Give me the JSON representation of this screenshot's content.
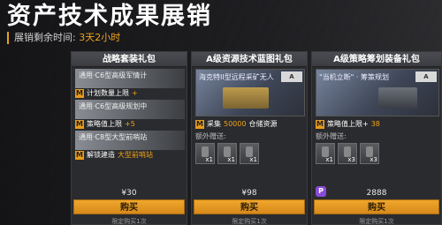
{
  "header": {
    "title": "资产技术成果展销",
    "remaining_label": "展销剩余时间:",
    "remaining_value": "3天2小时"
  },
  "cards": [
    {
      "title": "战略套装礼包",
      "items": [
        {
          "text": "通用·C6型高级军情计"
        },
        {
          "chip": "计划数量上限",
          "chip_suffix": "+"
        },
        {
          "text": "通用·C6型高级规划中"
        },
        {
          "chip": "策略值上限",
          "chip_suffix": "+5"
        },
        {
          "text": "通用·C8型大型前哨站"
        },
        {
          "chip": "解锁建造",
          "chip_hl": "大型前哨站"
        }
      ],
      "price": "¥30",
      "buy_label": "购买",
      "limit": "限定购买1次"
    },
    {
      "title": "A级资源技术蓝图礼包",
      "image_label": "海克特II型远程采矿无人",
      "level": "A",
      "chip_prefix": "采集",
      "chip_value": "50000",
      "chip_suffix": "仓储资源",
      "extra_label": "额外赠送:",
      "gifts": [
        "x1",
        "x1",
        "x1"
      ],
      "price": "¥98",
      "buy_label": "购买",
      "limit": "限定购买1次"
    },
    {
      "title": "A级策略筹划装备礼包",
      "image_label": "\"当机立断\" · 筹策规划",
      "level": "A",
      "chip_prefix": "策略值上限+",
      "chip_value": "38",
      "extra_label": "额外赠送:",
      "gifts": [
        "x1",
        "x3",
        "x3"
      ],
      "coin_icon": "P",
      "price": "2888",
      "buy_label": "购买",
      "limit": "限定购买1次"
    }
  ]
}
